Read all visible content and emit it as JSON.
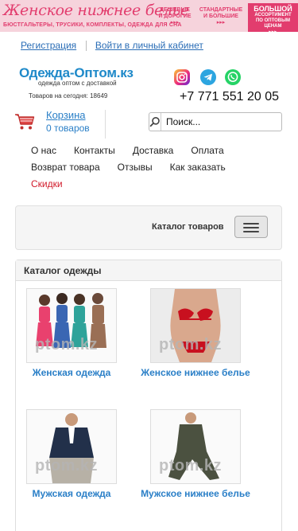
{
  "banner": {
    "title": "Женское нижнее белье",
    "subtitle": "БЮСТГАЛЬТЕРЫ, ТРУСИКИ, КОМПЛЕКТЫ, ОДЕЖДА ДЛЯ СНА",
    "block1_line1": "ДЕШЕВЫЕ",
    "block1_line2": "И ДОРОГИЕ",
    "block2_line1": "СТАНДАРТНЫЕ",
    "block2_line2": "И БОЛЬШИЕ",
    "block3_line1": "БОЛЬШОЙ",
    "block3_line2": "АССОРТИМЕНТ",
    "block3_line3": "ПО ОПТОВЫМ",
    "block3_line4": "ЦЕНАМ",
    "arrows": "▸▸▸"
  },
  "toplinks": {
    "register": "Регистрация",
    "login": "Войти в личный кабинет"
  },
  "logo": {
    "name": "Одежда-Оптом.кз",
    "tagline": "одежда оптом с доставкой",
    "goods_today": "Товаров на сегодня: 18649"
  },
  "socials": {
    "instagram": "instagram-icon",
    "telegram": "telegram-icon",
    "whatsapp": "whatsapp-icon"
  },
  "phone": "+7 771 551 20 05",
  "cart": {
    "title": "Корзина",
    "count": "0 товаров"
  },
  "search": {
    "placeholder": "Поиск..."
  },
  "nav": {
    "row1": [
      "О нас",
      "Контакты",
      "Доставка",
      "Оплата"
    ],
    "row2": [
      "Возврат товара",
      "Отзывы",
      "Как заказать"
    ],
    "sale": "Скидки"
  },
  "catalog_bar": {
    "label": "Каталог товаров"
  },
  "catalog": {
    "heading": "Каталог одежды",
    "watermark": "ptom.kz",
    "items": [
      {
        "label": "Женская одежда"
      },
      {
        "label": "Женское нижнее белье"
      },
      {
        "label": "Мужская одежда"
      },
      {
        "label": "Мужское нижнее белье"
      }
    ]
  },
  "colors": {
    "accent_pink": "#e23d6e",
    "link_blue": "#2a7fc7",
    "sale_red": "#d11a2a"
  }
}
